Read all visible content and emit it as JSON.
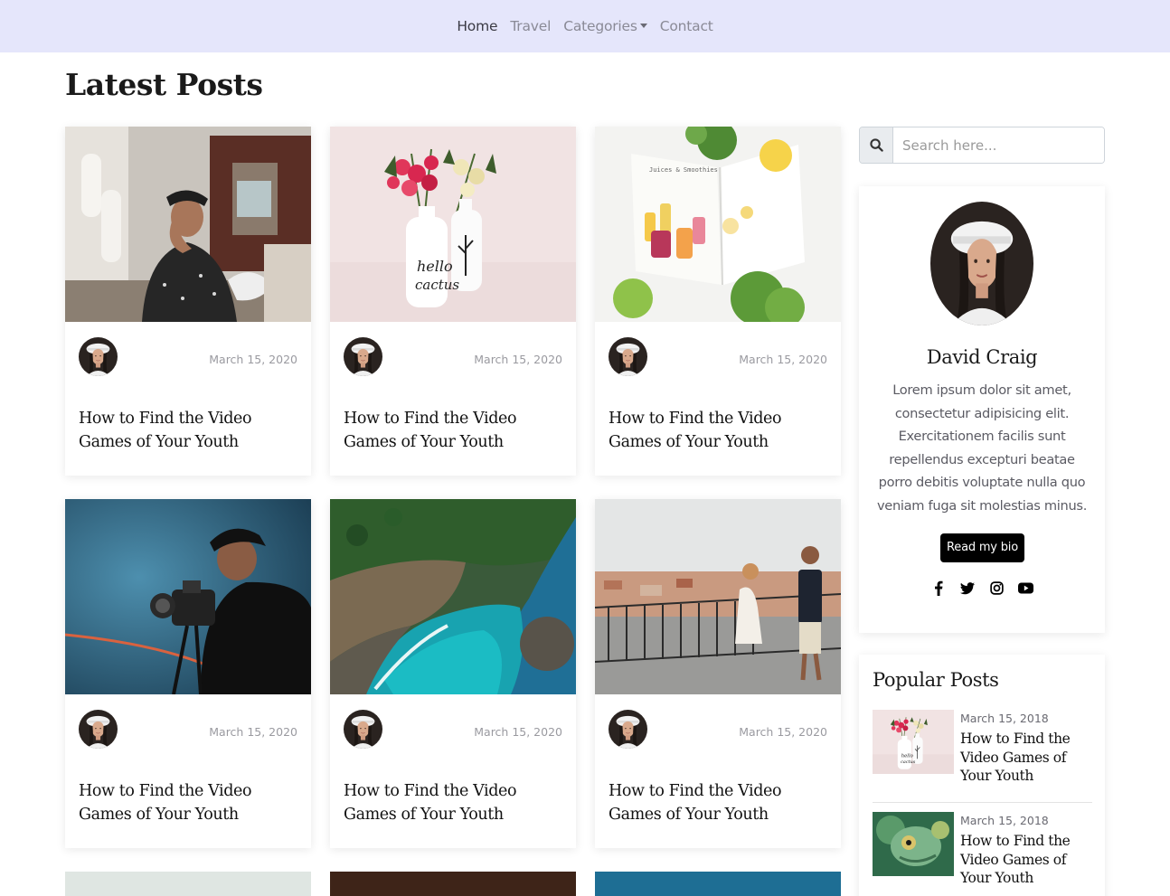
{
  "nav": {
    "items": [
      {
        "label": "Home"
      },
      {
        "label": "Travel"
      },
      {
        "label": "Categories"
      },
      {
        "label": "Contact"
      }
    ]
  },
  "main": {
    "title": "Latest Posts",
    "posts": [
      {
        "date": "March 15, 2020",
        "title": "How to Find the Video Games of Your Youth",
        "image": "man-in-airplane"
      },
      {
        "date": "March 15, 2020",
        "title": "How to Find the Video Games of Your Youth",
        "image": "flowers-in-vases"
      },
      {
        "date": "March 15, 2020",
        "title": "How to Find the Video Games of Your Youth",
        "image": "book-with-smoothies"
      },
      {
        "date": "March 15, 2020",
        "title": "How to Find the Video Games of Your Youth",
        "image": "cameraman"
      },
      {
        "date": "March 15, 2020",
        "title": "How to Find the Video Games of Your Youth",
        "image": "coastal-cove"
      },
      {
        "date": "March 15, 2020",
        "title": "How to Find the Video Games of Your Youth",
        "image": "couple-on-balcony"
      }
    ]
  },
  "sidebar": {
    "search": {
      "placeholder": "Search here..."
    },
    "bio": {
      "name": "David Craig",
      "text": "Lorem ipsum dolor sit amet, consectetur adipisicing elit. Exercitationem facilis sunt repellendus excepturi beatae porro debitis voluptate nulla quo veniam fuga sit molestias minus.",
      "button": "Read my bio",
      "socials": [
        "facebook-icon",
        "twitter-icon",
        "instagram-icon",
        "youtube-icon"
      ]
    },
    "popular": {
      "title": "Popular Posts",
      "items": [
        {
          "date": "March 15, 2018",
          "title": "How to Find the Video Games of Your Youth",
          "image": "flowers-in-vases"
        },
        {
          "date": "March 15, 2018",
          "title": "How to Find the Video Games of Your Youth",
          "image": "chameleon"
        }
      ]
    }
  },
  "colors": {
    "nav_bg": "#e5e6fb",
    "button_bg": "#000000",
    "accent_text": "#1a1a1a"
  }
}
